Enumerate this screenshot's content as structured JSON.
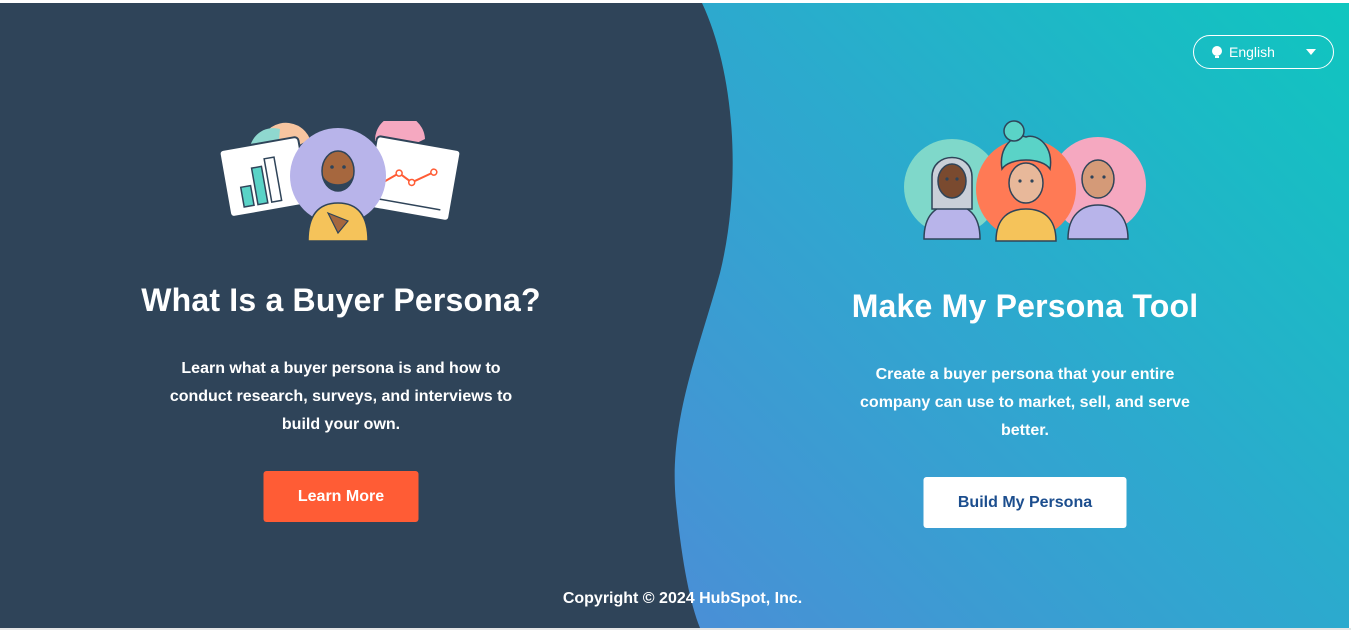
{
  "language_selector": {
    "icon": "globe-icon",
    "label": "English",
    "caret": "chevron-down-icon"
  },
  "left_panel": {
    "illustration": "buyer-persona-illustration",
    "title": "What Is a Buyer Persona?",
    "description": "Learn what a buyer persona is and how to conduct research, surveys, and interviews to build your own.",
    "button_label": "Learn More"
  },
  "right_panel": {
    "illustration": "persona-group-illustration",
    "title": "Make My Persona Tool",
    "description": "Create a buyer persona that your entire company can use to market, sell, and serve better.",
    "button_label": "Build My Persona"
  },
  "footer": {
    "copyright": "Copyright © 2024 HubSpot, Inc."
  },
  "colors": {
    "left_bg": "#2f4459",
    "accent_orange": "#ff5c35",
    "white_button_text": "#1c4e8e",
    "gradient_top_right": "#0fc6bf",
    "gradient_bottom_left": "#6b7fd8"
  }
}
